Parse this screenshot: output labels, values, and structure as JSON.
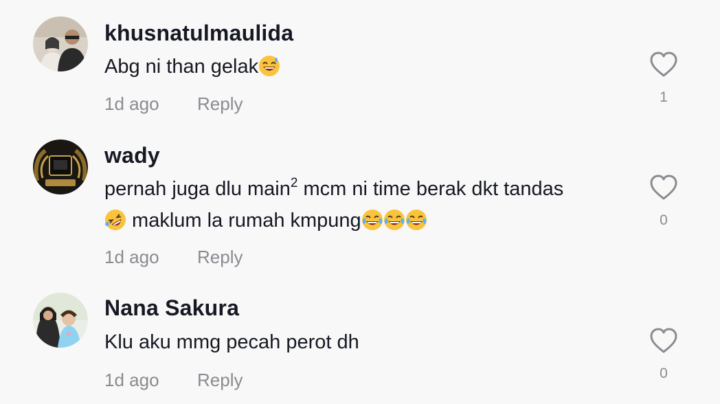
{
  "comments": [
    {
      "username": "khusnatulmaulida",
      "text": "Abg ni than gelak",
      "text_emojis": [
        "sweat-smile-emoji"
      ],
      "time": "1d ago",
      "reply_label": "Reply",
      "like_count": "1"
    },
    {
      "username": "wady",
      "text_part1": "pernah juga dlu main",
      "superscript": "2",
      "text_part2": " mcm ni time berak dkt tandas",
      "text_line2": " maklum la rumah kmpung",
      "text_emojis": [
        "rofl-emoji",
        "joy-emoji",
        "joy-emoji",
        "joy-emoji"
      ],
      "time": "1d ago",
      "reply_label": "Reply",
      "like_count": "0"
    },
    {
      "username": "Nana Sakura",
      "text": "Klu aku mmg pecah perot dh",
      "time": "1d ago",
      "reply_label": "Reply",
      "like_count": "0"
    }
  ],
  "colors": {
    "background": "#f8f8f8",
    "username": "#161823",
    "meta": "#8a8b91",
    "heart_outline": "#8a8b91"
  },
  "icons": {
    "like": "heart-outline-icon"
  }
}
